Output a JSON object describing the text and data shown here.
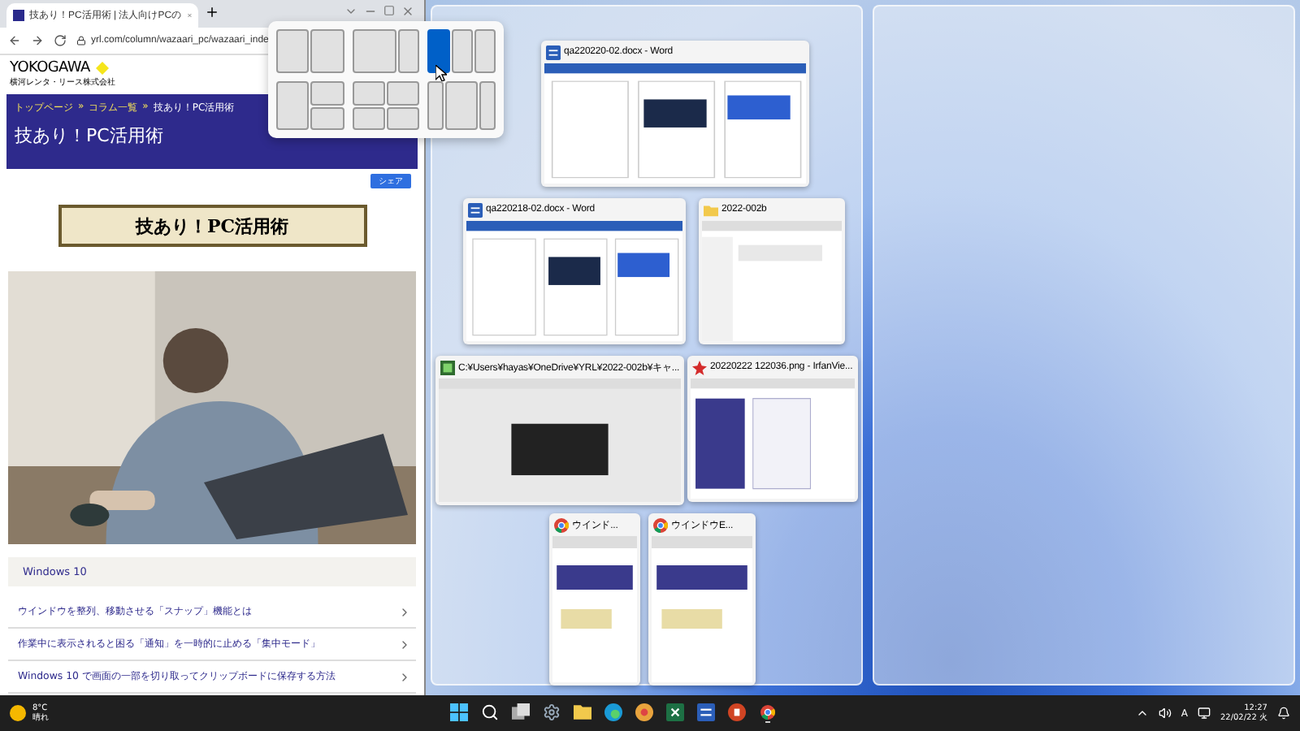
{
  "browser": {
    "tab_title": "技あり！PC活用術 | 法人向けPCの",
    "url": "yrl.com/column/wazaari_pc/wazaari_inde",
    "logo": {
      "name": "YOKOGAWA",
      "company": "横河レンタ・リース株式会社"
    },
    "breadcrumb": [
      "トップページ",
      "コラム一覧",
      "技あり！PC活用術"
    ],
    "breadcrumb_separator": "»",
    "page_title": "技あり！PC活用術",
    "share_label": "シェア",
    "banner_text": "技あり！PC活用術",
    "section_title": "Windows 10",
    "links": [
      {
        "label": "ウインドウを整列、移動させる「スナップ」機能とは"
      },
      {
        "label": "作業中に表示されると困る「通知」を一時的に止める「集中モード」"
      },
      {
        "label": "Windows 10 で画面の一部を切り取ってクリップボードに保存する方法"
      }
    ]
  },
  "snap_layouts": [
    {
      "kind": "halves",
      "zones": [
        {
          "selected": false
        },
        {
          "selected": false
        }
      ]
    },
    {
      "kind": "wide-left",
      "zones": [
        {
          "selected": false
        },
        {
          "selected": false
        }
      ]
    },
    {
      "kind": "thirds",
      "zones": [
        {
          "selected": true
        },
        {
          "selected": false
        },
        {
          "selected": false
        }
      ]
    },
    {
      "kind": "left-stack",
      "zones": [
        {
          "selected": false
        },
        {
          "selected": false
        },
        {
          "selected": false
        }
      ]
    },
    {
      "kind": "quad",
      "zones": [
        {
          "selected": false
        },
        {
          "selected": false
        },
        {
          "selected": false
        },
        {
          "selected": false
        }
      ]
    },
    {
      "kind": "wide-center",
      "zones": [
        {
          "selected": false
        },
        {
          "selected": false
        },
        {
          "selected": false
        }
      ]
    }
  ],
  "snap_assist": [
    {
      "kind": "word",
      "title": "qa220220-02.docx - Word"
    },
    {
      "kind": "word",
      "title": "qa220218-02.docx - Word"
    },
    {
      "kind": "folder",
      "title": "2022-002b"
    },
    {
      "kind": "app",
      "title": "C:¥Users¥hayas¥OneDrive¥YRL¥2022-002b¥キャ..."
    },
    {
      "kind": "viewer",
      "title": "20220222 122036.png - IrfanVie..."
    },
    {
      "kind": "chrome",
      "title": "ウインド..."
    },
    {
      "kind": "chrome",
      "title": "ウインドウE..."
    }
  ],
  "taskbar": {
    "weather": {
      "temp": "8°C",
      "condition": "晴れ"
    },
    "apps": [
      {
        "kind": "start",
        "active": false
      },
      {
        "kind": "search",
        "active": false
      },
      {
        "kind": "taskview",
        "active": false
      },
      {
        "kind": "settings",
        "active": false
      },
      {
        "kind": "explorer",
        "active": false
      },
      {
        "kind": "edge",
        "active": false
      },
      {
        "kind": "canary",
        "active": false
      },
      {
        "kind": "excel",
        "active": false
      },
      {
        "kind": "word",
        "active": false
      },
      {
        "kind": "powerpoint",
        "active": false
      },
      {
        "kind": "chrome",
        "active": true
      }
    ],
    "ime": "A",
    "time": "12:27",
    "date": "22/02/22 火"
  }
}
